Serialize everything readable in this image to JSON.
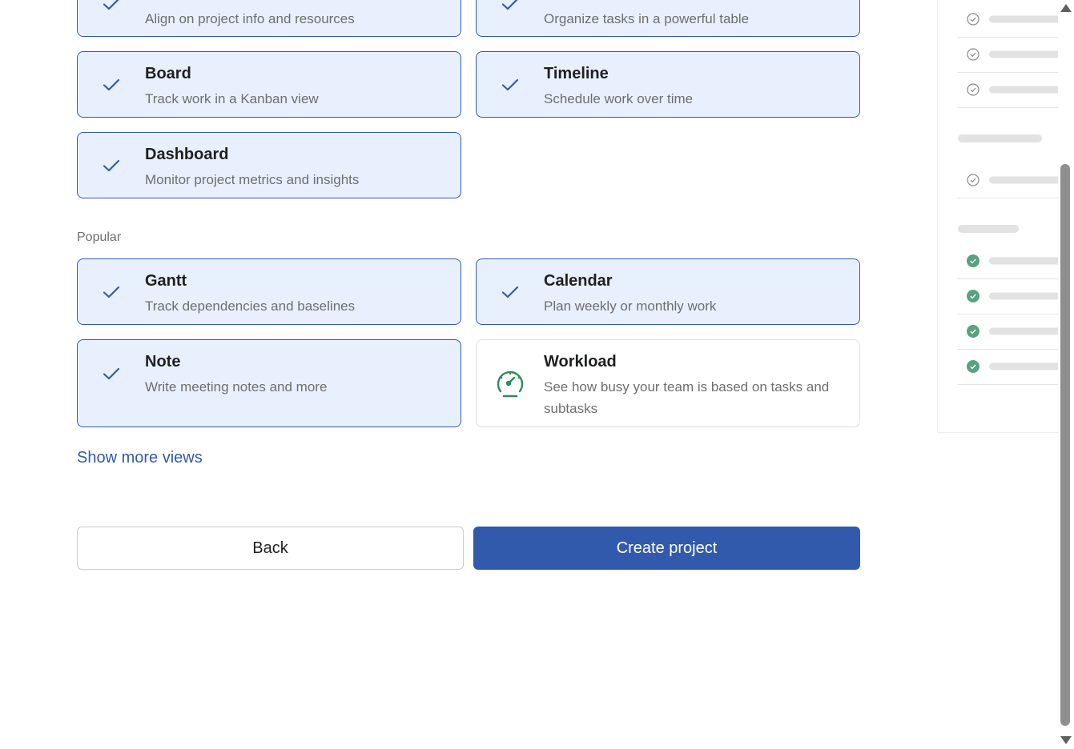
{
  "views": {
    "top_row": [
      {
        "title": "",
        "description": "Align on project info and resources",
        "selected": true,
        "icon": "check-icon"
      },
      {
        "title": "",
        "description": "Organize tasks in a powerful table",
        "selected": true,
        "icon": "check-icon"
      }
    ],
    "recommended": [
      {
        "title": "Board",
        "description": "Track work in a Kanban view",
        "selected": true,
        "icon": "check-icon"
      },
      {
        "title": "Timeline",
        "description": "Schedule work over time",
        "selected": true,
        "icon": "check-icon"
      },
      {
        "title": "Dashboard",
        "description": "Monitor project metrics and insights",
        "selected": true,
        "icon": "check-icon"
      }
    ],
    "popular_label": "Popular",
    "popular": [
      {
        "title": "Gantt",
        "description": "Track dependencies and baselines",
        "selected": true,
        "icon": "check-icon"
      },
      {
        "title": "Calendar",
        "description": "Plan weekly or monthly work",
        "selected": true,
        "icon": "check-icon"
      },
      {
        "title": "Note",
        "description": "Write meeting notes and more",
        "selected": true,
        "icon": "check-icon"
      },
      {
        "title": "Workload",
        "description": "See how busy your team is based on tasks and subtasks",
        "selected": false,
        "icon": "gauge-icon"
      }
    ]
  },
  "show_more_label": "Show more views",
  "buttons": {
    "back_label": "Back",
    "create_label": "Create project"
  },
  "colors": {
    "accent": "#315aad",
    "selected_bg": "#e9f0fd",
    "workload_icon": "#2e8b57",
    "done_check": "#58a182"
  }
}
